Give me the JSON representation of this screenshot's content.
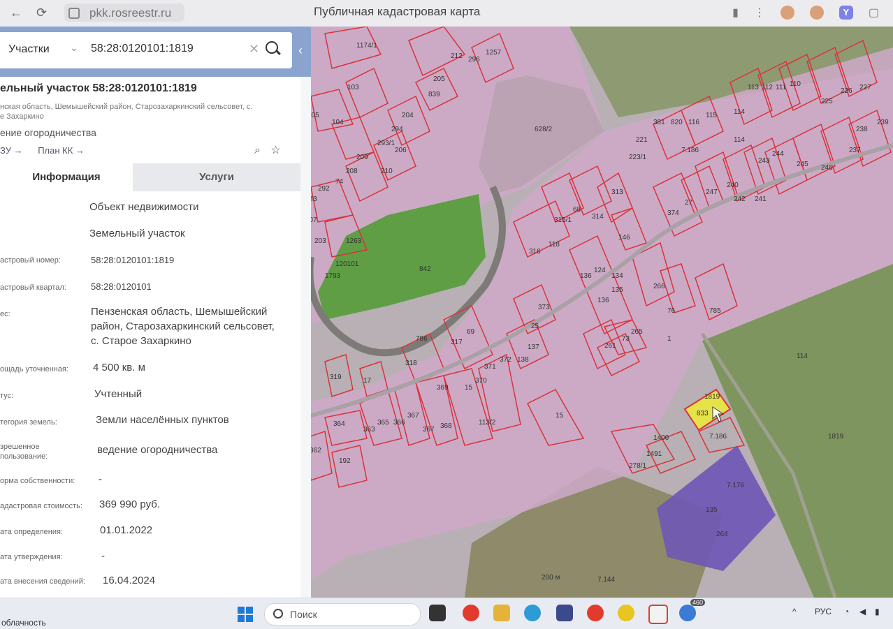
{
  "browser": {
    "url": "pkk.rosreestr.ru",
    "title": "Публичная кадастровая карта"
  },
  "search": {
    "type_label": "Участки",
    "query": "58:28:0120101:1819"
  },
  "card": {
    "title": "ельный участок 58:28:0120101:1819",
    "address_short": "нская область, Шемышейский район, Старозахаркинский сельсовет, с.\nе Захаркино",
    "use": "ение огородничества",
    "link_zu": "ЗУ →",
    "link_plan": "План КК →"
  },
  "tabs": {
    "info": "Информация",
    "services": "Услуги"
  },
  "fields": [
    {
      "label": "",
      "value": "Объект недвижимости"
    },
    {
      "label": "",
      "value": "Земельный участок"
    },
    {
      "label": "астровый номер:",
      "value": "58:28:0120101:1819"
    },
    {
      "label": "астровый квартал:",
      "value": "58:28:0120101"
    },
    {
      "label": "ес:",
      "value": "Пензенская область, Шемышейский\nрайон, Старозахаркинский сельсовет,\nс. Старое Захаркино"
    },
    {
      "label": "ощадь уточненная:",
      "value": "4 500 кв. м"
    },
    {
      "label": "тус:",
      "value": "Учтенный"
    },
    {
      "label": "тегория земель:",
      "value": "Земли населённых пунктов"
    },
    {
      "label": "зрешенное\nпользование:",
      "value": "ведение огородничества"
    },
    {
      "label": "орма собственности:",
      "value": "-"
    },
    {
      "label": "адастровая стоимость:",
      "value": "369 990 руб."
    },
    {
      "label": "ата определения:",
      "value": "01.01.2022"
    },
    {
      "label": "ата утверждения:",
      "value": "-"
    },
    {
      "label": "ата внесения сведений:",
      "value": "16.04.2024"
    }
  ],
  "map_labels": [
    "1174/1",
    "1257",
    "296",
    "212",
    "205",
    "839",
    "103",
    "105",
    "104",
    "204",
    "294",
    "293/1",
    "206",
    "210",
    "209",
    "208",
    "74",
    "292",
    "843",
    "207",
    "203",
    "1263",
    "120101",
    "1793",
    "842",
    "628/2",
    "316",
    "118",
    "315/1",
    "68",
    "314",
    "313",
    "146",
    "373",
    "25",
    "137",
    "138",
    "372",
    "371",
    "370",
    "369",
    "368",
    "367",
    "367",
    "366",
    "365",
    "363",
    "364",
    "362",
    "192",
    "319",
    "17",
    "318",
    "317",
    "69",
    "786",
    "136",
    "135",
    "134",
    "136",
    "124",
    "265",
    "73",
    "261",
    "266",
    "76",
    "1",
    "785",
    "374",
    "27",
    "247",
    "240",
    "242",
    "241",
    "243",
    "244",
    "245",
    "246",
    "237",
    "238",
    "239",
    "221",
    "223/1",
    "381",
    "820",
    "116",
    "115",
    "114",
    "113",
    "112",
    "111",
    "110",
    "225",
    "226",
    "227",
    "114",
    "114",
    "1819",
    "1819",
    "833",
    "7.186",
    "1400",
    "1491",
    "278/1",
    "7.176",
    "135",
    "264",
    "15",
    "15",
    "113/2",
    "200 м",
    "7.144",
    "7.186"
  ],
  "colors": {
    "parcel_fill": "#c9a8c5",
    "parcel_stroke": "#d9333a",
    "selected_fill": "#e6e24a",
    "purple_fill": "#6e56b6",
    "field_green": "#8aa36a",
    "forest_green": "#4f8a3c"
  },
  "taskbar": {
    "search_label": "Поиск",
    "lang": "РУС",
    "notif_badge": "460",
    "bottom_text": "облачность"
  }
}
